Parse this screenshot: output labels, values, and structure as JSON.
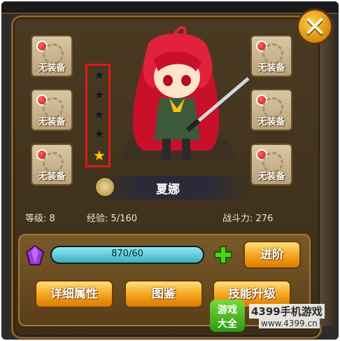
{
  "equipment_slots": [
    {
      "label": "无装备"
    },
    {
      "label": "无装备"
    },
    {
      "label": "无装备"
    },
    {
      "label": "无装备"
    },
    {
      "label": "无装备"
    },
    {
      "label": "无装备"
    }
  ],
  "stars": {
    "total": 5,
    "filled": 1
  },
  "hero": {
    "name": "夏娜"
  },
  "stats": {
    "level_label": "等级:",
    "level": "8",
    "exp_label": "经验:",
    "exp": "5/160",
    "power_label": "战斗力:",
    "power": "276"
  },
  "progress": {
    "text": "870/60",
    "fraction": 1.0
  },
  "buttons": {
    "advance": "进阶",
    "details": "详细属性",
    "codex": "图鉴",
    "skill_upgrade": "技能升级"
  },
  "watermark": {
    "logo_top": "游戏",
    "logo_bottom": "大全",
    "brand": "4399手机游戏",
    "url": "www.4399.cn"
  },
  "colors": {
    "accent": "#f5a21a",
    "frame": "#8a6326",
    "highlight_box": "#e01818",
    "bar": "#3ab0c0"
  }
}
